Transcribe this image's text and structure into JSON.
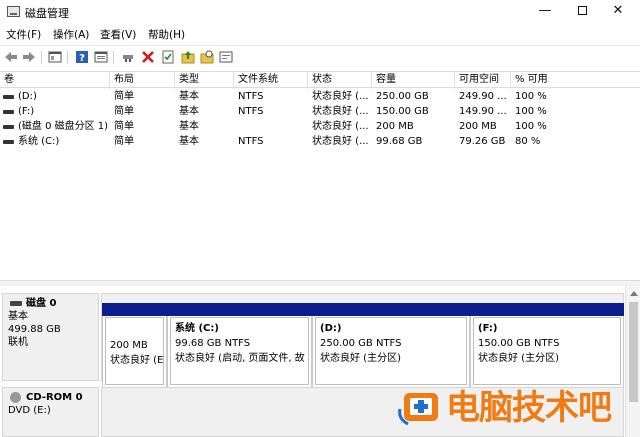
{
  "window": {
    "title": "磁盘管理"
  },
  "menu": [
    "文件(F)",
    "操作(A)",
    "查看(V)",
    "帮助(H)"
  ],
  "toolbar": {
    "buttons": [
      "back-arrow-icon",
      "forward-arrow-icon",
      "console-tree-icon",
      "help-icon",
      "properties-icon",
      "connect-icon",
      "delete-icon",
      "check-icon",
      "up-folder-icon",
      "search-folder-icon",
      "settings-icon"
    ],
    "colors": {
      "delete": "#d11a1a",
      "help": "#2b5fb3",
      "folder": "#e8c14a"
    }
  },
  "columns": [
    "卷",
    "布局",
    "类型",
    "文件系统",
    "状态",
    "容量",
    "可用空间",
    "% 可用"
  ],
  "volumes": [
    {
      "name": "(D:)",
      "layout": "简单",
      "type": "基本",
      "fs": "NTFS",
      "status": "状态良好 (...",
      "capacity": "250.00 GB",
      "free": "249.90 ...",
      "pct": "100 %"
    },
    {
      "name": "(F:)",
      "layout": "简单",
      "type": "基本",
      "fs": "NTFS",
      "status": "状态良好 (...",
      "capacity": "150.00 GB",
      "free": "149.90 ...",
      "pct": "100 %"
    },
    {
      "name": "(磁盘 0 磁盘分区 1)",
      "layout": "简单",
      "type": "基本",
      "fs": "",
      "status": "状态良好 (...",
      "capacity": "200 MB",
      "free": "200 MB",
      "pct": "100 %"
    },
    {
      "name": "系统 (C:)",
      "layout": "简单",
      "type": "基本",
      "fs": "NTFS",
      "status": "状态良好 (...",
      "capacity": "99.68 GB",
      "free": "79.26 GB",
      "pct": "80 %"
    }
  ],
  "disk0": {
    "name": "磁盘 0",
    "type": "基本",
    "size": "499.88 GB",
    "state": "联机",
    "partitions": [
      {
        "name": "",
        "size": "200 MB",
        "status": "状态良好 (E"
      },
      {
        "name": "系统 (C:)",
        "size": "99.68 GB NTFS",
        "status": "状态良好 (启动, 页面文件, 故"
      },
      {
        "name": "(D:)",
        "size": "250.00 GB NTFS",
        "status": "状态良好 (主分区)"
      },
      {
        "name": "(F:)",
        "size": "150.00 GB NTFS",
        "status": "状态良好 (主分区)"
      }
    ],
    "bar_color": "#0b1e8c"
  },
  "cdrom0": {
    "name": "CD-ROM 0",
    "desc": "DVD (E:)"
  },
  "watermark": {
    "text": "电脑技术吧",
    "color": "#f07b12"
  }
}
